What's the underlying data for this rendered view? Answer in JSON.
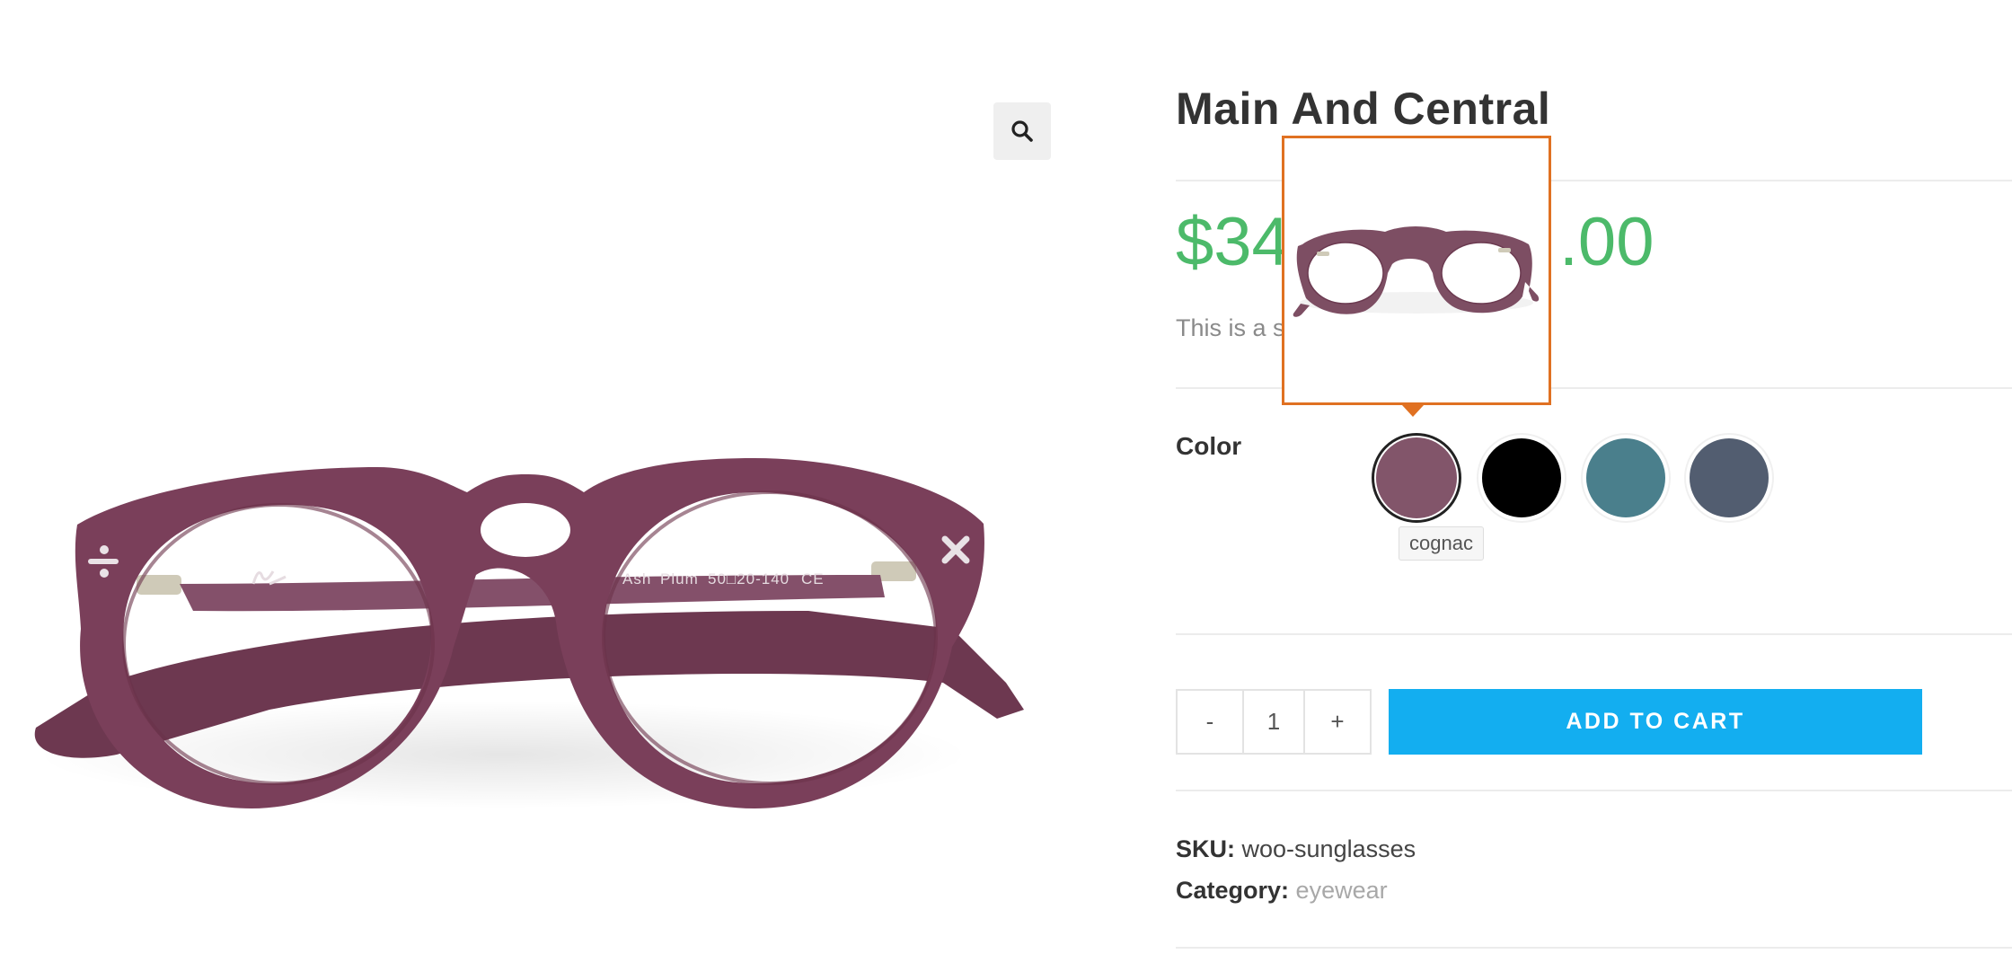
{
  "product": {
    "title": "Main And Central",
    "price_left": "$34",
    "price_right": ".00",
    "description": "This is a s",
    "frame_print": {
      "brand": "Ash",
      "color": "Plum",
      "size": "50□20-140",
      "mark": "CE"
    }
  },
  "gallery": {
    "zoom_icon": "search-icon"
  },
  "variation": {
    "label": "Color",
    "swatches": [
      {
        "name": "cognac",
        "color": "#82556a",
        "selected": true
      },
      {
        "name": "black",
        "color": "#000000",
        "selected": false
      },
      {
        "name": "teal",
        "color": "#4a7f8c",
        "selected": false
      },
      {
        "name": "slate",
        "color": "#525d70",
        "selected": false
      }
    ],
    "tooltip": "cognac",
    "preview_border_color": "#e07122"
  },
  "cart": {
    "minus_label": "-",
    "quantity": "1",
    "plus_label": "+",
    "add_to_cart_label": "ADD TO CART",
    "button_color": "#13aef0"
  },
  "meta": {
    "sku_label": "SKU:",
    "sku_value": "woo-sunglasses",
    "category_label": "Category:",
    "category_value": "eyewear"
  },
  "colors": {
    "price": "#4cba6a",
    "frame": "#7a3f5a"
  }
}
